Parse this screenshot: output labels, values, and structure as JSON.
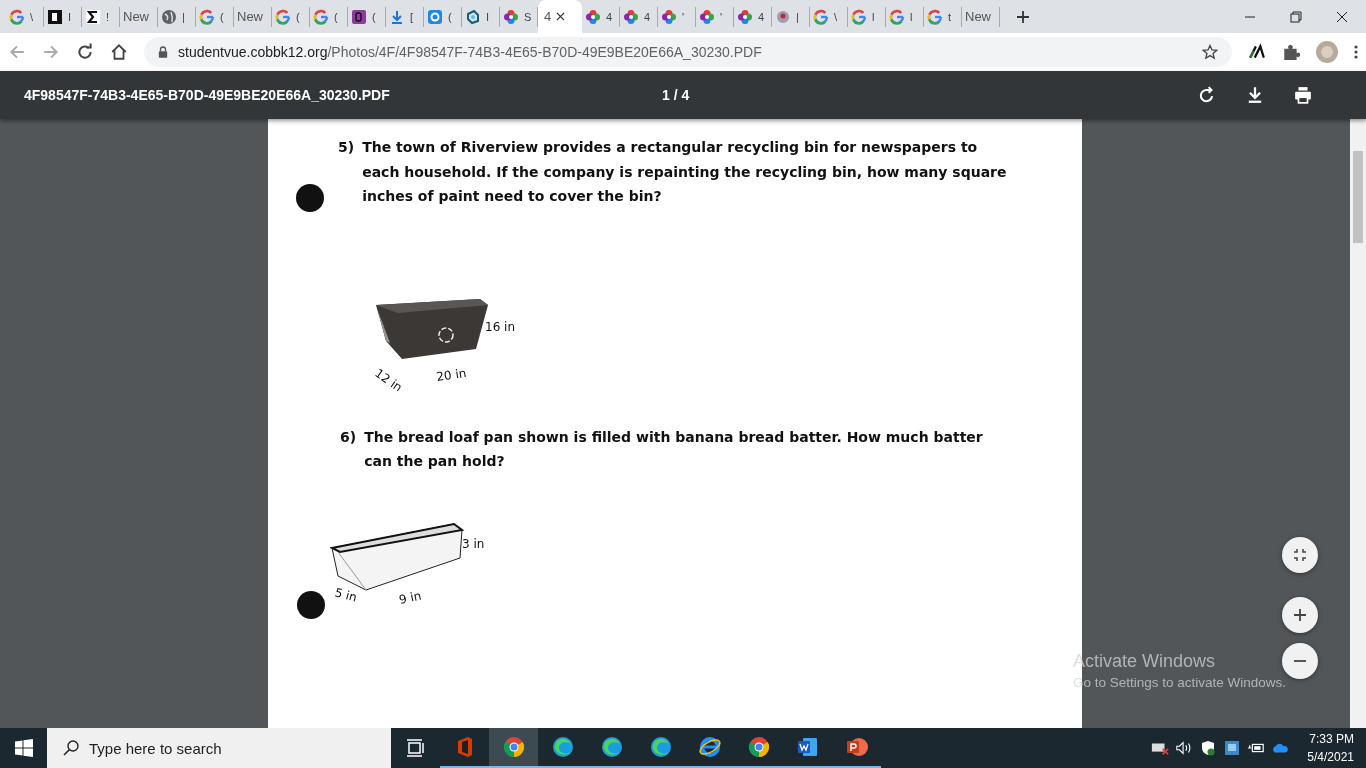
{
  "tabs": [
    {
      "kind": "google",
      "title": "\\",
      "selected": false
    },
    {
      "kind": "blackbox",
      "title": "I",
      "selected": false
    },
    {
      "kind": "sigma",
      "title": "!",
      "selected": false
    },
    {
      "kind": "none",
      "title": "New",
      "selected": false
    },
    {
      "kind": "globe",
      "title": "|",
      "selected": false
    },
    {
      "kind": "google",
      "title": "(",
      "selected": false
    },
    {
      "kind": "none",
      "title": "New",
      "selected": false
    },
    {
      "kind": "google",
      "title": "(",
      "selected": false
    },
    {
      "kind": "google",
      "title": "(",
      "selected": false
    },
    {
      "kind": "purple",
      "title": "(",
      "selected": false
    },
    {
      "kind": "download",
      "title": "[",
      "selected": false
    },
    {
      "kind": "bluecircle",
      "title": "(",
      "selected": false
    },
    {
      "kind": "tealsquare",
      "title": "I",
      "selected": false
    },
    {
      "kind": "flower",
      "title": "S",
      "selected": false
    },
    {
      "kind": "none",
      "title": "4",
      "selected": true
    },
    {
      "kind": "flower",
      "title": "4",
      "selected": false
    },
    {
      "kind": "flower",
      "title": "4",
      "selected": false
    },
    {
      "kind": "flower",
      "title": "'",
      "selected": false
    },
    {
      "kind": "flower",
      "title": "'",
      "selected": false
    },
    {
      "kind": "flower",
      "title": "4",
      "selected": false
    },
    {
      "kind": "avatar",
      "title": "|",
      "selected": false
    },
    {
      "kind": "google",
      "title": "\\",
      "selected": false
    },
    {
      "kind": "google",
      "title": "l",
      "selected": false
    },
    {
      "kind": "google",
      "title": "l",
      "selected": false
    },
    {
      "kind": "google",
      "title": "t",
      "selected": false
    },
    {
      "kind": "none",
      "title": "New",
      "selected": false
    }
  ],
  "address_bar": {
    "domain": "studentvue.cobbk12.org",
    "path": "/Photos/4F/4F98547F-74B3-4E65-B70D-49E9BE20E66A_30230.PDF"
  },
  "pdf_toolbar": {
    "filename": "4F98547F-74B3-4E65-B70D-49E9BE20E66A_30230.PDF",
    "page_indicator": "1 / 4"
  },
  "questions": [
    {
      "number": "5)",
      "text": "The town of Riverview provides a rectangular recycling bin for newspapers to each household.  If the company is repainting the recycling bin, how many square inches of paint need to cover the bin?",
      "kind": "bin",
      "labels": [
        "16 in",
        "12 in",
        "20 in"
      ]
    },
    {
      "number": "6)",
      "text": "The bread loaf pan shown is filled with banana bread batter.  How much batter can the pan hold?",
      "kind": "pan",
      "labels": [
        "3 in",
        "5 in",
        "9 in"
      ]
    }
  ],
  "activation_notice": {
    "title": "Activate Windows",
    "subtitle": "Go to Settings to activate Windows."
  },
  "taskbar": {
    "search_placeholder": "Type here to search",
    "apps": [
      {
        "kind": "taskview",
        "selected": false
      },
      {
        "kind": "office",
        "selected": false
      },
      {
        "kind": "chrome",
        "selected": true
      },
      {
        "kind": "edge",
        "selected": false
      },
      {
        "kind": "edge",
        "selected": false
      },
      {
        "kind": "edge",
        "selected": false
      },
      {
        "kind": "ie",
        "selected": false
      },
      {
        "kind": "chrome",
        "selected": false
      },
      {
        "kind": "word",
        "selected": false
      },
      {
        "kind": "powerpoint",
        "selected": false
      }
    ],
    "time": "7:33 PM",
    "date": "5/4/2021"
  }
}
